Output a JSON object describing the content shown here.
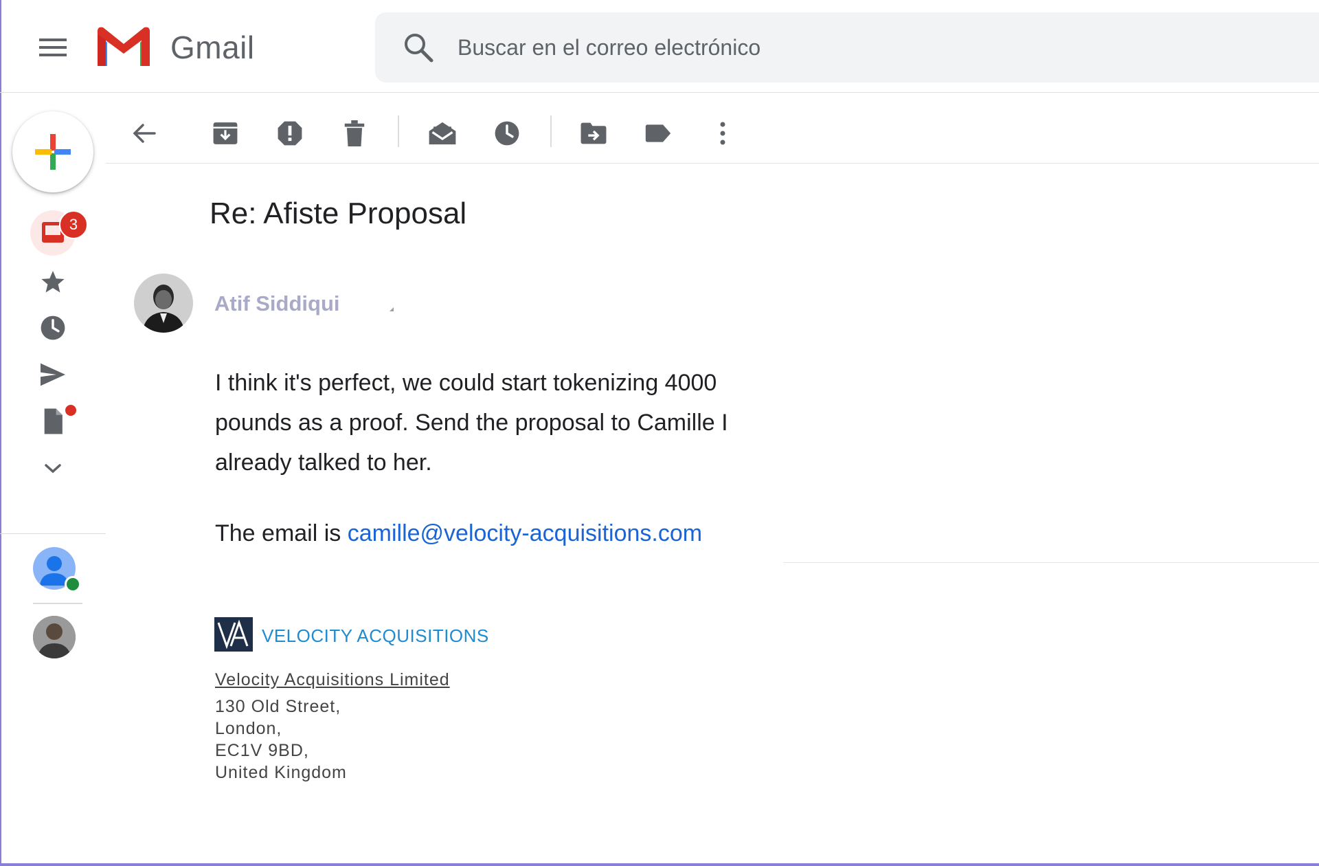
{
  "header": {
    "brand": "Gmail",
    "search_placeholder": "Buscar en el correo electrónico"
  },
  "toolbar": {
    "icons": [
      "back-arrow-icon",
      "archive-icon",
      "report-spam-icon",
      "delete-icon",
      "mark-unread-icon",
      "snooze-icon",
      "move-to-icon",
      "label-icon",
      "more-vert-icon"
    ]
  },
  "sidebar": {
    "inbox_badge": "3",
    "icons": [
      "compose-plus-icon",
      "inbox-icon",
      "star-icon",
      "clock-icon",
      "send-icon",
      "draft-icon",
      "chevron-down-icon"
    ]
  },
  "message": {
    "subject": "Re: Afiste Proposal",
    "sender": "Atif Siddiqui",
    "body_lines": [
      "I think it's perfect, we could start tokenizing 4000",
      "pounds as a proof. Send the proposal to Camille I",
      "already talked to her."
    ],
    "email_prefix": "The email is",
    "email_link": "camille@velocity-acquisitions.com"
  },
  "signature": {
    "logo_text": "VA",
    "brand_name": "VELOCITY ACQUISITIONS",
    "company": "Velocity Acquisitions Limited",
    "address": [
      "130 Old Street,",
      "London,",
      "EC1V 9BD,",
      "United Kingdom"
    ]
  },
  "colors": {
    "link": "#1a64d6",
    "badge": "#d93025",
    "sender_name": "#a9a9c8",
    "signature_blue": "#1f8bd0"
  }
}
